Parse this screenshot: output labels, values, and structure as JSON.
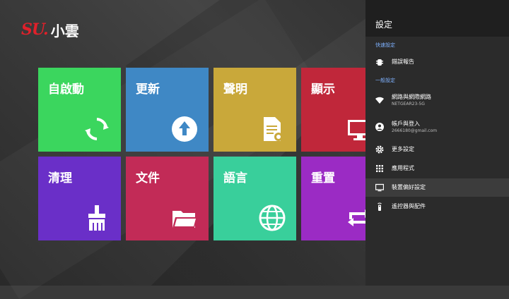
{
  "brand": {
    "mark": "SU.",
    "name": "小雲"
  },
  "tiles": [
    {
      "label": "自啟動",
      "icon": "sync-icon",
      "color": "#3bd65e"
    },
    {
      "label": "更新",
      "icon": "upload-icon",
      "color": "#3f88c5"
    },
    {
      "label": "聲明",
      "icon": "document-icon",
      "color": "#c9a83a"
    },
    {
      "label": "顯示",
      "icon": "monitor-icon",
      "color": "#c0273a"
    },
    {
      "label": "清理",
      "icon": "broom-icon",
      "color": "#6a2fc8"
    },
    {
      "label": "文件",
      "icon": "folder-icon",
      "color": "#c22b57"
    },
    {
      "label": "語言",
      "icon": "globe-icon",
      "color": "#39cf9b"
    },
    {
      "label": "重置",
      "icon": "repeat-icon",
      "color": "#9b2bc4"
    }
  ],
  "settings": {
    "title": "設定",
    "sections": {
      "quick": "快速設定",
      "general": "一般設定"
    },
    "items": [
      {
        "label": "錯誤報告",
        "icon": "bug-icon"
      },
      {
        "label": "網路與網際網路",
        "sub": "NETGEAR23-5G",
        "icon": "wifi-icon"
      },
      {
        "label": "帳戶與登入",
        "sub": "2666180@gmail.com",
        "icon": "account-icon"
      },
      {
        "label": "更多設定",
        "icon": "gear-icon"
      },
      {
        "label": "應用程式",
        "icon": "apps-icon"
      },
      {
        "label": "裝置偏好設定",
        "icon": "tv-icon"
      },
      {
        "label": "遙控器與配件",
        "icon": "remote-icon"
      }
    ]
  },
  "colors": {
    "accent": "#7fb2ff",
    "brand_red": "#e0202a"
  }
}
